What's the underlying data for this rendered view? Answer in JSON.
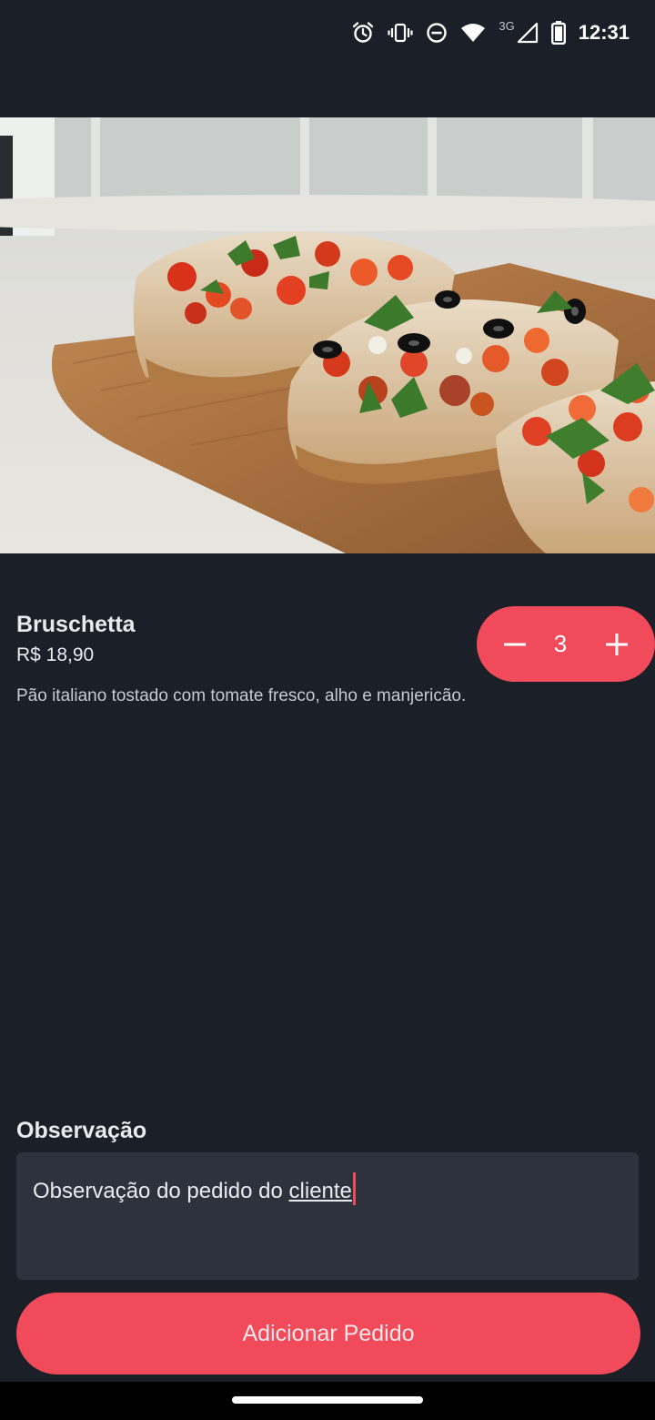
{
  "status_bar": {
    "time": "12:31",
    "network": "3G",
    "icons": [
      "alarm-icon",
      "vibrate-icon",
      "do-not-disturb-icon",
      "wifi-icon",
      "signal-icon",
      "battery-icon"
    ]
  },
  "hero": {
    "image": "bruschetta-photo"
  },
  "product": {
    "name": "Bruschetta",
    "price": "R$ 18,90",
    "description": "Pão italiano tostado com tomate fresco, alho e manjericão."
  },
  "quantity": {
    "value": "3",
    "decrement_icon": "minus-icon",
    "increment_icon": "plus-icon"
  },
  "observation": {
    "label": "Observação",
    "value_prefix": "Observação do pedido do ",
    "value_underlined": "cliente"
  },
  "actions": {
    "add_label": "Adicionar Pedido"
  },
  "colors": {
    "background": "#1a1f28",
    "accent": "#f14b5b",
    "field": "#2e323c"
  }
}
